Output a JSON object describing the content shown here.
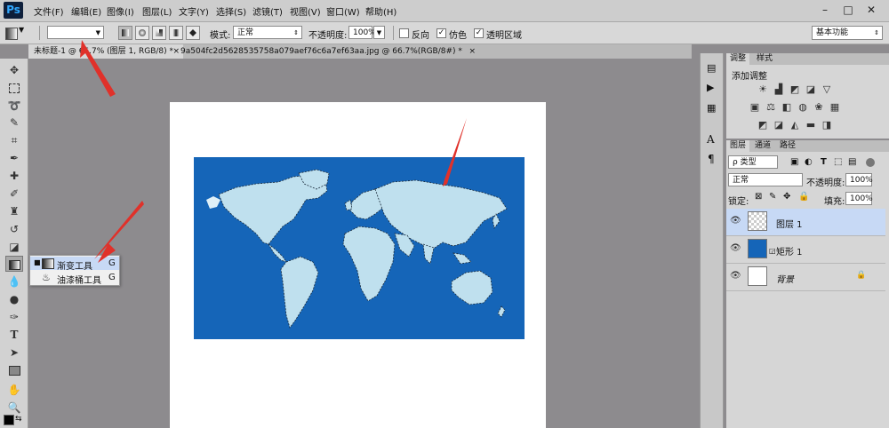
{
  "app": {
    "logo": "Ps"
  },
  "menu": [
    "文件(F)",
    "编辑(E)",
    "图像(I)",
    "图层(L)",
    "文字(Y)",
    "选择(S)",
    "滤镜(T)",
    "视图(V)",
    "窗口(W)",
    "帮助(H)"
  ],
  "window_buttons": [
    "–",
    "□",
    "✕"
  ],
  "options": {
    "mode_label": "模式:",
    "mode_value": "正常",
    "opacity_label": "不透明度:",
    "opacity_value": "100%",
    "reverse_label": "反向",
    "dither_label": "仿色",
    "transparency_label": "透明区域",
    "reverse_checked": false,
    "dither_checked": true,
    "transparency_checked": true,
    "workspace": "基本功能"
  },
  "tabs": [
    {
      "label": "未标题-1 @ 66.7% (图层 1, RGB/8) *",
      "close": "×"
    },
    {
      "label": "9a504fc2d5628535758a079aef76c6a7ef63aa.jpg @ 66.7%(RGB/8#) *",
      "close": "×"
    }
  ],
  "flyout": {
    "items": [
      {
        "label": "渐变工具",
        "shortcut": "G",
        "active": true
      },
      {
        "label": "油漆桶工具",
        "shortcut": "G",
        "active": false
      }
    ]
  },
  "adjust_panel": {
    "tabs": [
      "调整",
      "样式"
    ],
    "title": "添加调整"
  },
  "layers_panel": {
    "tabs": [
      "图层",
      "通道",
      "路径"
    ],
    "filter_label": "ρ 类型",
    "blend_mode": "正常",
    "opacity_label": "不透明度:",
    "opacity_value": "100%",
    "lock_label": "锁定:",
    "fill_label": "填充:",
    "fill_value": "100%",
    "layers": [
      {
        "name": "图层 1",
        "selected": true
      },
      {
        "name": "矩形 1",
        "selected": false
      },
      {
        "name": "背景",
        "selected": false
      }
    ]
  },
  "colors": {
    "map_ocean": "#1565b8",
    "map_land": "#bfe0ee",
    "arrow": "#e0312a",
    "selected_layer": "#c7d9f5"
  }
}
